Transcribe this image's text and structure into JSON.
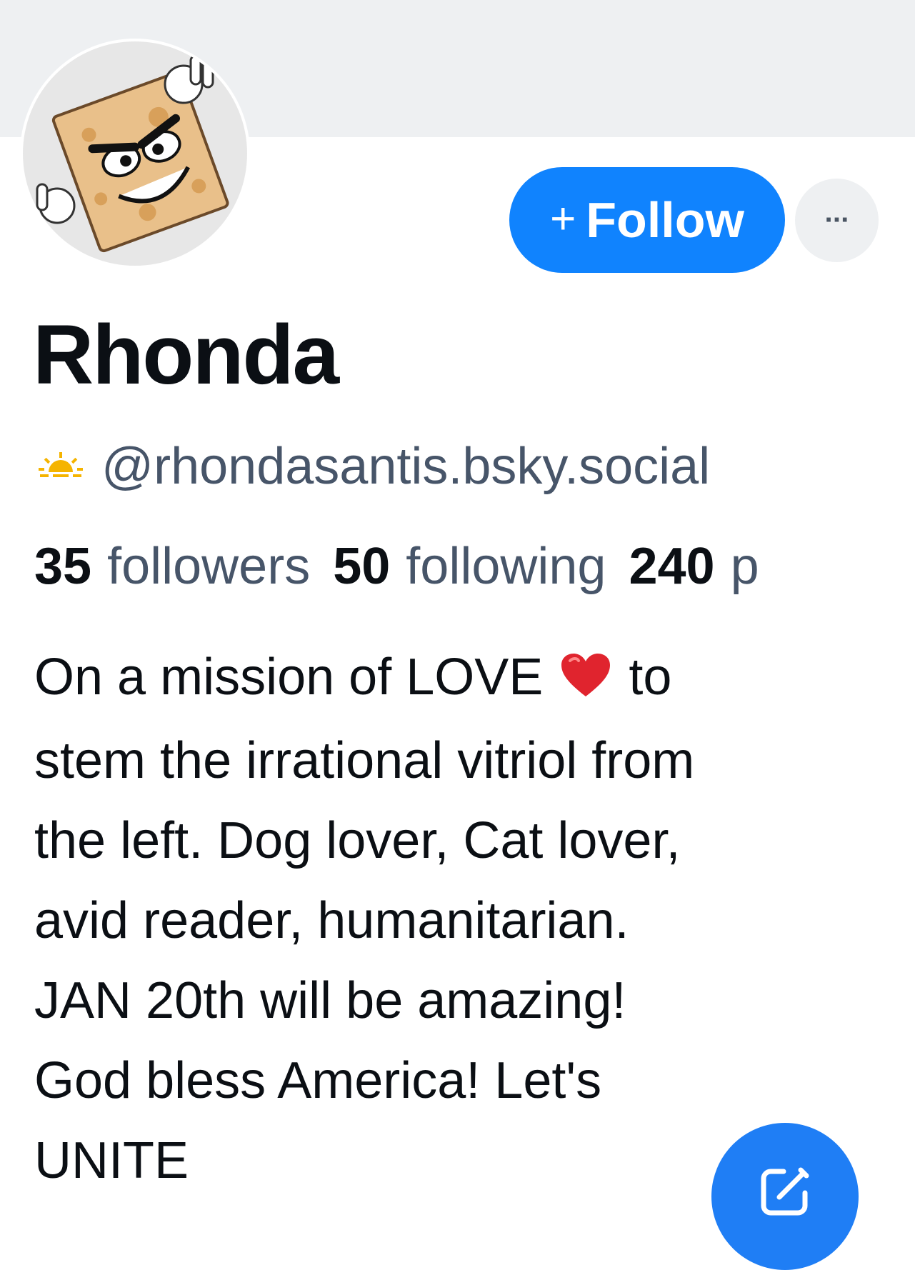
{
  "profile": {
    "display_name": "Rhonda",
    "handle": "@rhondasantis.bsky.social",
    "handle_icon": "sun-icon",
    "stats": {
      "followers_count": "35",
      "followers_label": "followers",
      "following_count": "50",
      "following_label": "following",
      "posts_count": "240",
      "posts_label": "p"
    },
    "bio": {
      "line1_a": "On a mission of LOVE",
      "line1_b": "to",
      "rest": "stem the irrational vitriol from\nthe left. Dog lover, Cat lover,\navid reader, humanitarian.\nJAN 20th will be amazing!\nGod bless America! Let's\nUNITE"
    }
  },
  "actions": {
    "follow_plus": "+",
    "follow_label": "Follow",
    "more_label": "···"
  },
  "colors": {
    "banner": "#eef0f2",
    "primary": "#1083fe",
    "handle_text": "#475569",
    "fab": "#1f7ef5"
  }
}
